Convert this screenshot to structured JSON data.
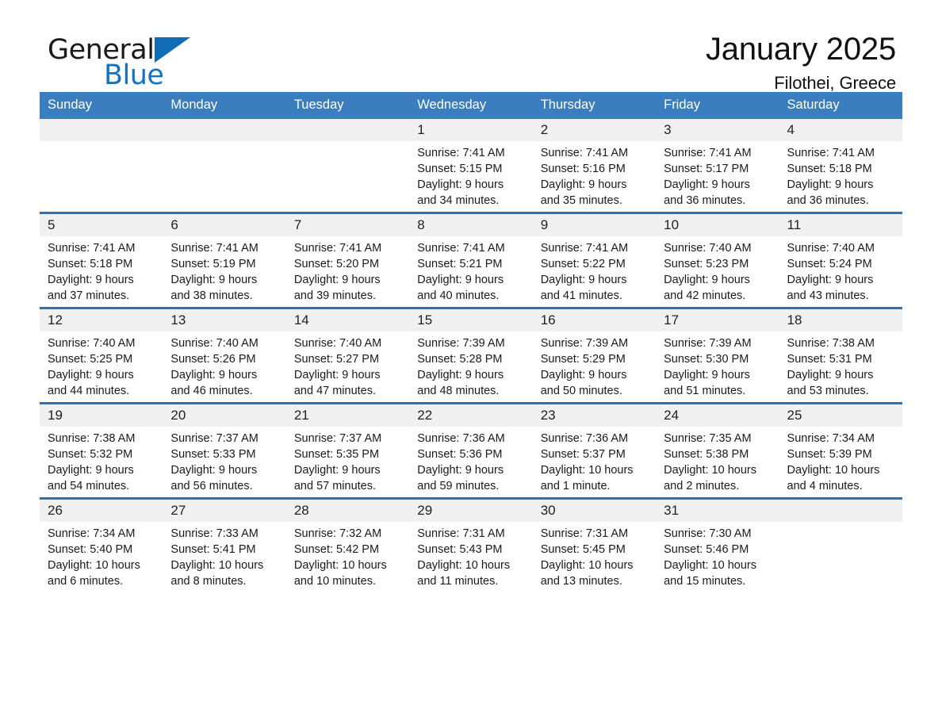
{
  "brand": {
    "name_part1": "General",
    "name_part2": "Blue",
    "triangle_color": "#0f6cb5",
    "blue_text_color": "#1273c4"
  },
  "header": {
    "title": "January 2025",
    "location": "Filothei, Greece"
  },
  "theme": {
    "header_row_bg": "#3a7ebf",
    "row_separator": "#2f6fae",
    "daynum_bg": "#f0f0f0",
    "text": "#1a1a1a"
  },
  "columns": [
    "Sunday",
    "Monday",
    "Tuesday",
    "Wednesday",
    "Thursday",
    "Friday",
    "Saturday"
  ],
  "weeks": [
    [
      {
        "day": "",
        "empty": true,
        "sunrise": "",
        "sunset": "",
        "daylight1": "",
        "daylight2": ""
      },
      {
        "day": "",
        "empty": true,
        "sunrise": "",
        "sunset": "",
        "daylight1": "",
        "daylight2": ""
      },
      {
        "day": "",
        "empty": true,
        "sunrise": "",
        "sunset": "",
        "daylight1": "",
        "daylight2": ""
      },
      {
        "day": "1",
        "sunrise": "Sunrise: 7:41 AM",
        "sunset": "Sunset: 5:15 PM",
        "daylight1": "Daylight: 9 hours",
        "daylight2": "and 34 minutes."
      },
      {
        "day": "2",
        "sunrise": "Sunrise: 7:41 AM",
        "sunset": "Sunset: 5:16 PM",
        "daylight1": "Daylight: 9 hours",
        "daylight2": "and 35 minutes."
      },
      {
        "day": "3",
        "sunrise": "Sunrise: 7:41 AM",
        "sunset": "Sunset: 5:17 PM",
        "daylight1": "Daylight: 9 hours",
        "daylight2": "and 36 minutes."
      },
      {
        "day": "4",
        "sunrise": "Sunrise: 7:41 AM",
        "sunset": "Sunset: 5:18 PM",
        "daylight1": "Daylight: 9 hours",
        "daylight2": "and 36 minutes."
      }
    ],
    [
      {
        "day": "5",
        "sunrise": "Sunrise: 7:41 AM",
        "sunset": "Sunset: 5:18 PM",
        "daylight1": "Daylight: 9 hours",
        "daylight2": "and 37 minutes."
      },
      {
        "day": "6",
        "sunrise": "Sunrise: 7:41 AM",
        "sunset": "Sunset: 5:19 PM",
        "daylight1": "Daylight: 9 hours",
        "daylight2": "and 38 minutes."
      },
      {
        "day": "7",
        "sunrise": "Sunrise: 7:41 AM",
        "sunset": "Sunset: 5:20 PM",
        "daylight1": "Daylight: 9 hours",
        "daylight2": "and 39 minutes."
      },
      {
        "day": "8",
        "sunrise": "Sunrise: 7:41 AM",
        "sunset": "Sunset: 5:21 PM",
        "daylight1": "Daylight: 9 hours",
        "daylight2": "and 40 minutes."
      },
      {
        "day": "9",
        "sunrise": "Sunrise: 7:41 AM",
        "sunset": "Sunset: 5:22 PM",
        "daylight1": "Daylight: 9 hours",
        "daylight2": "and 41 minutes."
      },
      {
        "day": "10",
        "sunrise": "Sunrise: 7:40 AM",
        "sunset": "Sunset: 5:23 PM",
        "daylight1": "Daylight: 9 hours",
        "daylight2": "and 42 minutes."
      },
      {
        "day": "11",
        "sunrise": "Sunrise: 7:40 AM",
        "sunset": "Sunset: 5:24 PM",
        "daylight1": "Daylight: 9 hours",
        "daylight2": "and 43 minutes."
      }
    ],
    [
      {
        "day": "12",
        "sunrise": "Sunrise: 7:40 AM",
        "sunset": "Sunset: 5:25 PM",
        "daylight1": "Daylight: 9 hours",
        "daylight2": "and 44 minutes."
      },
      {
        "day": "13",
        "sunrise": "Sunrise: 7:40 AM",
        "sunset": "Sunset: 5:26 PM",
        "daylight1": "Daylight: 9 hours",
        "daylight2": "and 46 minutes."
      },
      {
        "day": "14",
        "sunrise": "Sunrise: 7:40 AM",
        "sunset": "Sunset: 5:27 PM",
        "daylight1": "Daylight: 9 hours",
        "daylight2": "and 47 minutes."
      },
      {
        "day": "15",
        "sunrise": "Sunrise: 7:39 AM",
        "sunset": "Sunset: 5:28 PM",
        "daylight1": "Daylight: 9 hours",
        "daylight2": "and 48 minutes."
      },
      {
        "day": "16",
        "sunrise": "Sunrise: 7:39 AM",
        "sunset": "Sunset: 5:29 PM",
        "daylight1": "Daylight: 9 hours",
        "daylight2": "and 50 minutes."
      },
      {
        "day": "17",
        "sunrise": "Sunrise: 7:39 AM",
        "sunset": "Sunset: 5:30 PM",
        "daylight1": "Daylight: 9 hours",
        "daylight2": "and 51 minutes."
      },
      {
        "day": "18",
        "sunrise": "Sunrise: 7:38 AM",
        "sunset": "Sunset: 5:31 PM",
        "daylight1": "Daylight: 9 hours",
        "daylight2": "and 53 minutes."
      }
    ],
    [
      {
        "day": "19",
        "sunrise": "Sunrise: 7:38 AM",
        "sunset": "Sunset: 5:32 PM",
        "daylight1": "Daylight: 9 hours",
        "daylight2": "and 54 minutes."
      },
      {
        "day": "20",
        "sunrise": "Sunrise: 7:37 AM",
        "sunset": "Sunset: 5:33 PM",
        "daylight1": "Daylight: 9 hours",
        "daylight2": "and 56 minutes."
      },
      {
        "day": "21",
        "sunrise": "Sunrise: 7:37 AM",
        "sunset": "Sunset: 5:35 PM",
        "daylight1": "Daylight: 9 hours",
        "daylight2": "and 57 minutes."
      },
      {
        "day": "22",
        "sunrise": "Sunrise: 7:36 AM",
        "sunset": "Sunset: 5:36 PM",
        "daylight1": "Daylight: 9 hours",
        "daylight2": "and 59 minutes."
      },
      {
        "day": "23",
        "sunrise": "Sunrise: 7:36 AM",
        "sunset": "Sunset: 5:37 PM",
        "daylight1": "Daylight: 10 hours",
        "daylight2": "and 1 minute."
      },
      {
        "day": "24",
        "sunrise": "Sunrise: 7:35 AM",
        "sunset": "Sunset: 5:38 PM",
        "daylight1": "Daylight: 10 hours",
        "daylight2": "and 2 minutes."
      },
      {
        "day": "25",
        "sunrise": "Sunrise: 7:34 AM",
        "sunset": "Sunset: 5:39 PM",
        "daylight1": "Daylight: 10 hours",
        "daylight2": "and 4 minutes."
      }
    ],
    [
      {
        "day": "26",
        "sunrise": "Sunrise: 7:34 AM",
        "sunset": "Sunset: 5:40 PM",
        "daylight1": "Daylight: 10 hours",
        "daylight2": "and 6 minutes."
      },
      {
        "day": "27",
        "sunrise": "Sunrise: 7:33 AM",
        "sunset": "Sunset: 5:41 PM",
        "daylight1": "Daylight: 10 hours",
        "daylight2": "and 8 minutes."
      },
      {
        "day": "28",
        "sunrise": "Sunrise: 7:32 AM",
        "sunset": "Sunset: 5:42 PM",
        "daylight1": "Daylight: 10 hours",
        "daylight2": "and 10 minutes."
      },
      {
        "day": "29",
        "sunrise": "Sunrise: 7:31 AM",
        "sunset": "Sunset: 5:43 PM",
        "daylight1": "Daylight: 10 hours",
        "daylight2": "and 11 minutes."
      },
      {
        "day": "30",
        "sunrise": "Sunrise: 7:31 AM",
        "sunset": "Sunset: 5:45 PM",
        "daylight1": "Daylight: 10 hours",
        "daylight2": "and 13 minutes."
      },
      {
        "day": "31",
        "sunrise": "Sunrise: 7:30 AM",
        "sunset": "Sunset: 5:46 PM",
        "daylight1": "Daylight: 10 hours",
        "daylight2": "and 15 minutes."
      },
      {
        "day": "",
        "empty": true,
        "sunrise": "",
        "sunset": "",
        "daylight1": "",
        "daylight2": ""
      }
    ]
  ]
}
